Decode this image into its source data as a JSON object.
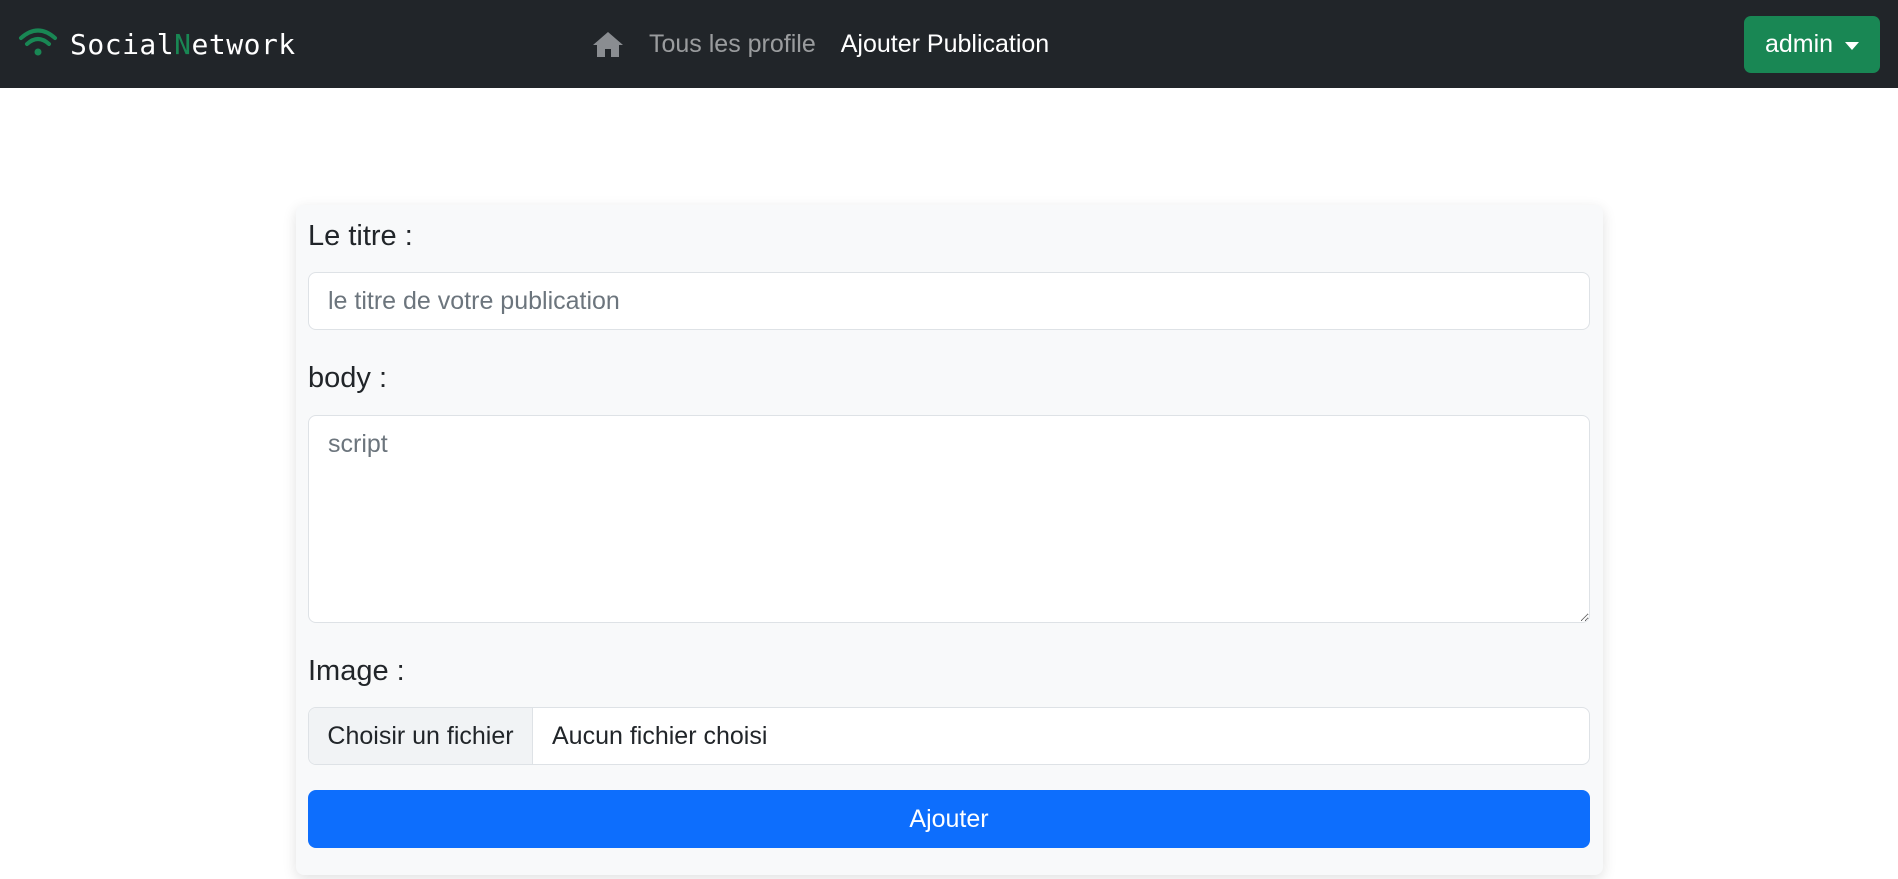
{
  "navbar": {
    "brand": {
      "part1": "Social",
      "accent": "N",
      "part2": "etwork",
      "icon": "wifi-icon"
    },
    "home_icon": "home-icon",
    "links": [
      {
        "label": "Tous les profile"
      },
      {
        "label": "Ajouter Publication"
      }
    ],
    "user_menu": {
      "label": "admin"
    }
  },
  "form": {
    "title": {
      "label": "Le titre :",
      "placeholder": "le titre de votre publication",
      "value": ""
    },
    "body": {
      "label": "body :",
      "placeholder": "script",
      "value": ""
    },
    "image": {
      "label": "Image :",
      "button_label": "Choisir un fichier",
      "file_status": "Aucun fichier choisi"
    },
    "submit_label": "Ajouter"
  },
  "colors": {
    "navbar_bg": "#212529",
    "brand_accent": "#198754",
    "user_button": "#198754",
    "primary": "#0d6efd",
    "card_bg": "#f8f9fa"
  }
}
